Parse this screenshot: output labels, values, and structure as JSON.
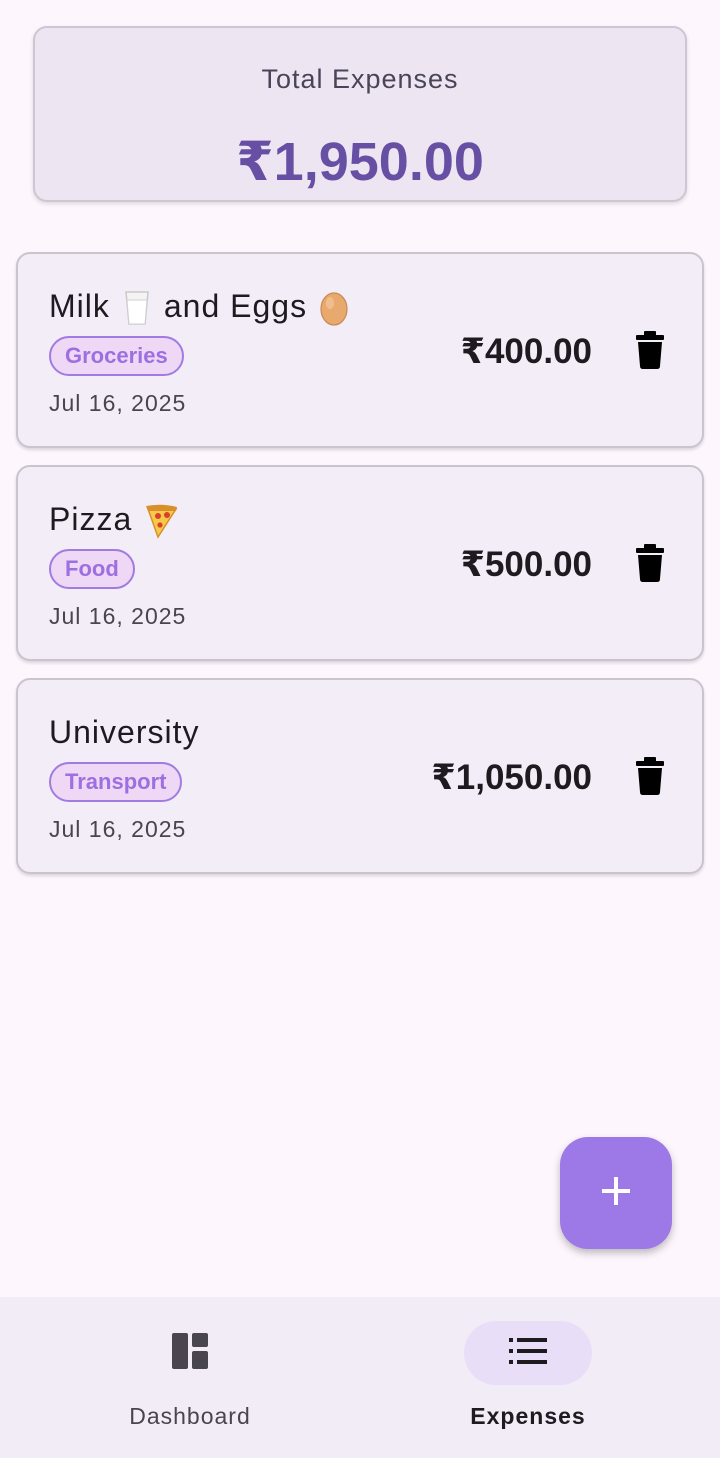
{
  "summary": {
    "label": "Total Expenses",
    "amount": "₹1,950.00"
  },
  "expenses": [
    {
      "title_parts": [
        "Milk",
        "and Eggs"
      ],
      "emojis": [
        "milk-glass-emoji",
        "egg-emoji"
      ],
      "category": "Groceries",
      "date": "Jul 16, 2025",
      "amount": "₹400.00"
    },
    {
      "title_parts": [
        "Pizza"
      ],
      "emojis": [
        "pizza-emoji"
      ],
      "category": "Food",
      "date": "Jul 16, 2025",
      "amount": "₹500.00"
    },
    {
      "title_parts": [
        "University"
      ],
      "emojis": [],
      "category": "Transport",
      "date": "Jul 16, 2025",
      "amount": "₹1,050.00"
    }
  ],
  "fab": {
    "icon": "plus-icon"
  },
  "nav": {
    "items": [
      {
        "label": "Dashboard",
        "icon": "dashboard-icon",
        "active": false
      },
      {
        "label": "Expenses",
        "icon": "list-icon",
        "active": true
      }
    ]
  },
  "colors": {
    "primary": "#6750a4",
    "fab": "#9c79e6",
    "chip_text": "#9d6fe0",
    "background": "#fdf7fd"
  }
}
